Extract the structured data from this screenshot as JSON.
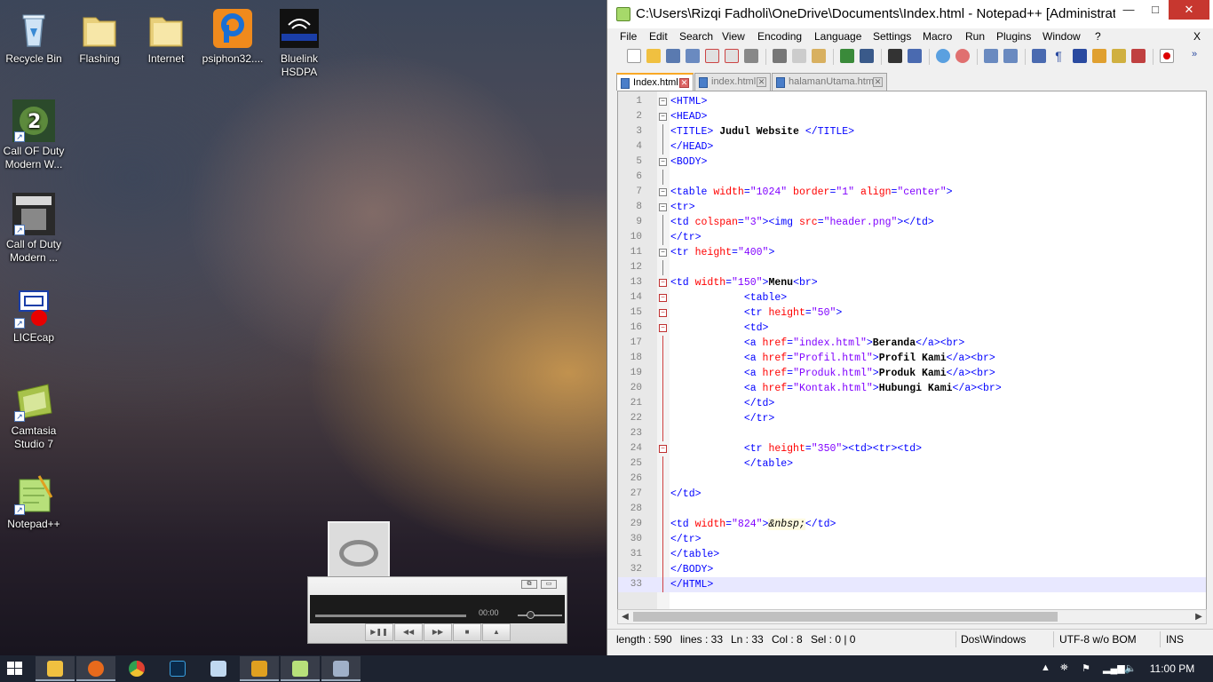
{
  "desktop": {
    "icons": [
      {
        "label": "Recycle Bin",
        "icon": "recycle-bin-icon"
      },
      {
        "label": "Flashing",
        "icon": "folder-icon"
      },
      {
        "label": "Internet",
        "icon": "folder-icon"
      },
      {
        "label": "psiphon32....",
        "icon": "psiphon-icon"
      },
      {
        "label": "Bluelink HSDPA",
        "icon": "bluelink-icon"
      },
      {
        "label": "Call OF Duty Modern W...",
        "icon": "call-of-duty-icon"
      },
      {
        "label": "Call of Duty Modern ...",
        "icon": "call-of-duty-mw3-icon"
      },
      {
        "label": "LICEcap",
        "icon": "licecap-icon"
      },
      {
        "label": "Camtasia Studio 7",
        "icon": "camtasia-icon"
      },
      {
        "label": "Notepad++",
        "icon": "notepadpp-icon"
      }
    ]
  },
  "media_player": {
    "time": "00:00"
  },
  "npp": {
    "title": "C:\\Users\\Rizqi Fadholi\\OneDrive\\Documents\\Index.html - Notepad++ [Administrator]",
    "window_buttons": {
      "minimize": "—",
      "maximize": "□",
      "close": "✕"
    },
    "menu": [
      "File",
      "Edit",
      "Search",
      "View",
      "Encoding",
      "Language",
      "Settings",
      "Macro",
      "Run",
      "Plugins",
      "Window",
      "?"
    ],
    "menu_close": "X",
    "tabs": [
      {
        "label": "Index.html",
        "active": true
      },
      {
        "label": "index.html",
        "active": false
      },
      {
        "label": "halamanUtama.html",
        "active": false
      }
    ],
    "status": {
      "length": "length : 590",
      "lines": "lines : 33",
      "ln": "Ln : 33",
      "col": "Col : 8",
      "sel": "Sel : 0 | 0",
      "eol": "Dos\\Windows",
      "encoding": "UTF-8 w/o BOM",
      "mode": "INS"
    },
    "code": [
      {
        "n": "1",
        "fold": "box",
        "parts": [
          [
            "tag",
            "<HTML>"
          ]
        ]
      },
      {
        "n": "2",
        "fold": "box",
        "parts": [
          [
            "tag",
            "<HEAD>"
          ]
        ]
      },
      {
        "n": "3",
        "fold": "line",
        "parts": [
          [
            "tag",
            "<TITLE>"
          ],
          [
            "plain",
            " Judul Website "
          ],
          [
            "tag",
            "</TITLE>"
          ]
        ]
      },
      {
        "n": "4",
        "fold": "line",
        "parts": [
          [
            "tag",
            "</HEAD>"
          ]
        ]
      },
      {
        "n": "5",
        "fold": "box",
        "parts": [
          [
            "tag",
            "<BODY>"
          ]
        ]
      },
      {
        "n": "6",
        "fold": "line",
        "parts": []
      },
      {
        "n": "7",
        "fold": "box",
        "parts": [
          [
            "tag",
            "<table "
          ],
          [
            "attr",
            "width"
          ],
          [
            "tag",
            "="
          ],
          [
            "val",
            "\"1024\" "
          ],
          [
            "attr",
            "border"
          ],
          [
            "tag",
            "="
          ],
          [
            "val",
            "\"1\" "
          ],
          [
            "attr",
            "align"
          ],
          [
            "tag",
            "="
          ],
          [
            "val",
            "\"center\""
          ],
          [
            "tag",
            ">"
          ]
        ]
      },
      {
        "n": "8",
        "fold": "box",
        "parts": [
          [
            "tag",
            "<tr>"
          ]
        ]
      },
      {
        "n": "9",
        "fold": "line",
        "parts": [
          [
            "tag",
            "<td "
          ],
          [
            "attr",
            "colspan"
          ],
          [
            "tag",
            "="
          ],
          [
            "val",
            "\"3\""
          ],
          [
            "tag",
            "><img "
          ],
          [
            "attr",
            "src"
          ],
          [
            "tag",
            "="
          ],
          [
            "val",
            "\"header.png\""
          ],
          [
            "tag",
            "></td>"
          ]
        ]
      },
      {
        "n": "10",
        "fold": "line",
        "parts": [
          [
            "tag",
            "</tr>"
          ]
        ]
      },
      {
        "n": "11",
        "fold": "box",
        "parts": [
          [
            "tag",
            "<tr "
          ],
          [
            "attr",
            "height"
          ],
          [
            "tag",
            "="
          ],
          [
            "val",
            "\"400\""
          ],
          [
            "tag",
            ">"
          ]
        ]
      },
      {
        "n": "12",
        "fold": "line",
        "parts": []
      },
      {
        "n": "13",
        "fold": "boxred",
        "parts": [
          [
            "tag",
            "<td "
          ],
          [
            "attr",
            "width"
          ],
          [
            "tag",
            "="
          ],
          [
            "val",
            "\"150\""
          ],
          [
            "tag",
            ">"
          ],
          [
            "plain",
            "Menu"
          ],
          [
            "tag",
            "<br>"
          ]
        ]
      },
      {
        "n": "14",
        "fold": "boxred",
        "parts": [
          [
            "plain",
            "            "
          ],
          [
            "tag",
            "<table>"
          ]
        ]
      },
      {
        "n": "15",
        "fold": "boxred",
        "parts": [
          [
            "plain",
            "            "
          ],
          [
            "tag",
            "<tr "
          ],
          [
            "attr",
            "height"
          ],
          [
            "tag",
            "="
          ],
          [
            "val",
            "\"50\""
          ],
          [
            "tag",
            ">"
          ]
        ]
      },
      {
        "n": "16",
        "fold": "boxred",
        "parts": [
          [
            "plain",
            "            "
          ],
          [
            "tag",
            "<td>"
          ]
        ]
      },
      {
        "n": "17",
        "fold": "red",
        "parts": [
          [
            "plain",
            "            "
          ],
          [
            "tag",
            "<a "
          ],
          [
            "attr",
            "href"
          ],
          [
            "tag",
            "="
          ],
          [
            "val",
            "\"index.html\""
          ],
          [
            "tag",
            ">"
          ],
          [
            "plain",
            "Beranda"
          ],
          [
            "tag",
            "</a><br>"
          ]
        ]
      },
      {
        "n": "18",
        "fold": "red",
        "parts": [
          [
            "plain",
            "            "
          ],
          [
            "tag",
            "<a "
          ],
          [
            "attr",
            "href"
          ],
          [
            "tag",
            "="
          ],
          [
            "val",
            "\"Profil.html\""
          ],
          [
            "tag",
            ">"
          ],
          [
            "plain",
            "Profil Kami"
          ],
          [
            "tag",
            "</a><br>"
          ]
        ]
      },
      {
        "n": "19",
        "fold": "red",
        "parts": [
          [
            "plain",
            "            "
          ],
          [
            "tag",
            "<a "
          ],
          [
            "attr",
            "href"
          ],
          [
            "tag",
            "="
          ],
          [
            "val",
            "\"Produk.html\""
          ],
          [
            "tag",
            ">"
          ],
          [
            "plain",
            "Produk Kami"
          ],
          [
            "tag",
            "</a><br>"
          ]
        ]
      },
      {
        "n": "20",
        "fold": "red",
        "parts": [
          [
            "plain",
            "            "
          ],
          [
            "tag",
            "<a "
          ],
          [
            "attr",
            "href"
          ],
          [
            "tag",
            "="
          ],
          [
            "val",
            "\"Kontak.html\""
          ],
          [
            "tag",
            ">"
          ],
          [
            "plain",
            "Hubungi Kami"
          ],
          [
            "tag",
            "</a><br>"
          ]
        ]
      },
      {
        "n": "21",
        "fold": "red",
        "parts": [
          [
            "plain",
            "            "
          ],
          [
            "tag",
            "</td>"
          ]
        ]
      },
      {
        "n": "22",
        "fold": "red",
        "parts": [
          [
            "plain",
            "            "
          ],
          [
            "tag",
            "</tr>"
          ]
        ]
      },
      {
        "n": "23",
        "fold": "red",
        "parts": []
      },
      {
        "n": "24",
        "fold": "boxred",
        "parts": [
          [
            "plain",
            "            "
          ],
          [
            "tag",
            "<tr "
          ],
          [
            "attr",
            "height"
          ],
          [
            "tag",
            "="
          ],
          [
            "val",
            "\"350\""
          ],
          [
            "tag",
            "><td><tr><td>"
          ]
        ]
      },
      {
        "n": "25",
        "fold": "red",
        "parts": [
          [
            "plain",
            "            "
          ],
          [
            "tag",
            "</table>"
          ]
        ]
      },
      {
        "n": "26",
        "fold": "red",
        "parts": []
      },
      {
        "n": "27",
        "fold": "red",
        "parts": [
          [
            "tag",
            "</td>"
          ]
        ]
      },
      {
        "n": "28",
        "fold": "red",
        "parts": []
      },
      {
        "n": "29",
        "fold": "red",
        "parts": [
          [
            "tag",
            "<td "
          ],
          [
            "attr",
            "width"
          ],
          [
            "tag",
            "="
          ],
          [
            "val",
            "\"824\""
          ],
          [
            "tag",
            ">"
          ],
          [
            "ent",
            "&nbsp;"
          ],
          [
            "tag",
            "</td>"
          ]
        ]
      },
      {
        "n": "30",
        "fold": "red",
        "parts": [
          [
            "tag",
            "</tr>"
          ]
        ]
      },
      {
        "n": "31",
        "fold": "red",
        "parts": [
          [
            "tag",
            "</table>"
          ]
        ]
      },
      {
        "n": "32",
        "fold": "red",
        "parts": [
          [
            "tag",
            "</BODY>"
          ]
        ]
      },
      {
        "n": "33",
        "fold": "red",
        "parts": [
          [
            "tag",
            "</HTML>"
          ]
        ],
        "current": true
      }
    ]
  },
  "taskbar": {
    "clock": "11:00 PM",
    "apps": [
      "file-explorer-icon",
      "firefox-icon",
      "chrome-icon",
      "photoshop-icon",
      "notepad-icon",
      "media-player-icon",
      "notepadpp-icon",
      "calculator-icon"
    ]
  },
  "colors": {
    "tag": "#0000ff",
    "attribute": "#ff0000",
    "value": "#8000ff",
    "close_button": "#c7372f",
    "taskbar": "#1d2330"
  }
}
